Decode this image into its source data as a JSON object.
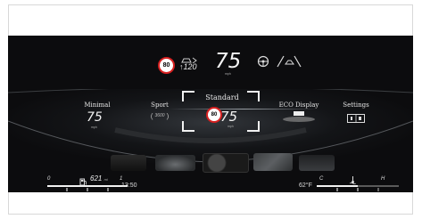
{
  "cluster": {
    "speed_limit_sign": "80",
    "set_speed": "120",
    "current_speed": "75",
    "current_speed_unit": "mph"
  },
  "modes": [
    {
      "label": "Minimal",
      "value": "75",
      "unit": "mph"
    },
    {
      "label": "Sport",
      "value": "3600"
    },
    {
      "label": "Standard",
      "value": "75",
      "unit": "mph",
      "sign": "80"
    },
    {
      "label": "ECO Display"
    },
    {
      "label": "Settings"
    }
  ],
  "bottom": {
    "fuel_left": "0",
    "fuel_range": "621",
    "fuel_range_unit": "mi",
    "fuel_right": "1",
    "clock": "13:50",
    "outside_temp": "62°F",
    "temp_left": "C",
    "temp_right": "H"
  },
  "icons": [
    "speed-limit-sign",
    "distance-assist-icon",
    "steering-assist-icon",
    "lane-assist-icon",
    "fuel-pump-icon",
    "coolant-temp-icon"
  ]
}
